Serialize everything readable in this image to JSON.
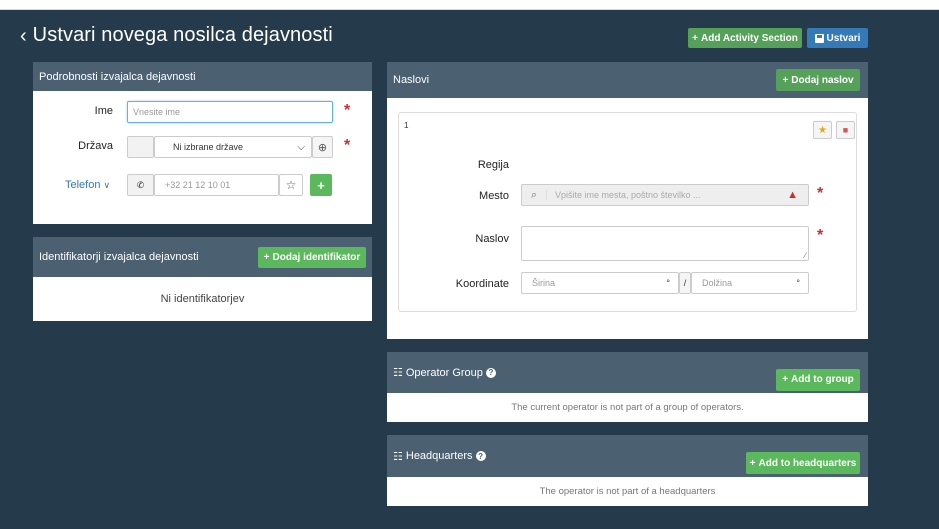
{
  "header": {
    "back_icon": "chevron-left-icon",
    "title": "Ustvari novega nosilca dejavnosti",
    "add_activity_label": "Add Activity Section",
    "create_label": "Ustvari"
  },
  "details": {
    "title": "Podrobnosti izvajalca dejavnosti",
    "name_label": "Ime",
    "name_placeholder": "Vnesite ime",
    "country_label": "Država",
    "country_value": "Ni izbrane države",
    "phone_label": "Telefon",
    "phone_placeholder": "+32 21 12 10 01"
  },
  "identifiers": {
    "title": "Identifikatorji izvajalca dejavnosti",
    "add_label": "Dodaj identifikator",
    "empty_text": "Ni identifikatorjev"
  },
  "addresses": {
    "title": "Naslovi",
    "add_label": "Dodaj naslov",
    "card_index": "1",
    "region_label": "Regija",
    "city_label": "Mesto",
    "city_placeholder": "Vpišite ime mesta, poštno številko ...",
    "address_label": "Naslov",
    "coords_label": "Koordinate",
    "lat_placeholder": "Širina",
    "lon_placeholder": "Dolžina",
    "deg": "°",
    "sep": "/"
  },
  "group": {
    "title": "Operator Group",
    "add_label": "Add to group",
    "empty_text": "The current operator is not part of a group of operators."
  },
  "hq": {
    "title": "Headquarters",
    "add_label": "Add to headquarters",
    "empty_text": "The operator is not part of a headquarters"
  },
  "colors": {
    "background": "#253a4a",
    "panel_header": "#4b6070",
    "green": "#5cb85c",
    "blue": "#337ab7",
    "required": "#c9302c"
  }
}
